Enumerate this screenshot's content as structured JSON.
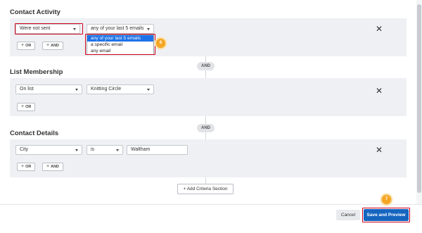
{
  "contact_activity": {
    "title": "Contact Activity",
    "condition": "Were not sent",
    "scope": "any of your last 5 emails",
    "scope_options": [
      "any of your last 5 emails",
      "a specific email",
      "any email"
    ],
    "or_label": "OR",
    "and_label": "AND",
    "step_number": "6"
  },
  "joiner_1": "AND",
  "list_membership": {
    "title": "List Membership",
    "condition": "On list",
    "list": "Knitting Circle",
    "or_label": "OR"
  },
  "joiner_2": "AND",
  "contact_details": {
    "title": "Contact Details",
    "field": "City",
    "operator": "is",
    "value": "Waltham",
    "or_label": "OR",
    "and_label": "AND"
  },
  "add_criteria_label": "+ Add Criteria Section",
  "footer": {
    "cancel_label": "Cancel",
    "save_label": "Save and Preview",
    "step_number": "7"
  },
  "colors": {
    "highlight": "#d0021b",
    "primary": "#1565c0",
    "badge": "#f5a623"
  }
}
